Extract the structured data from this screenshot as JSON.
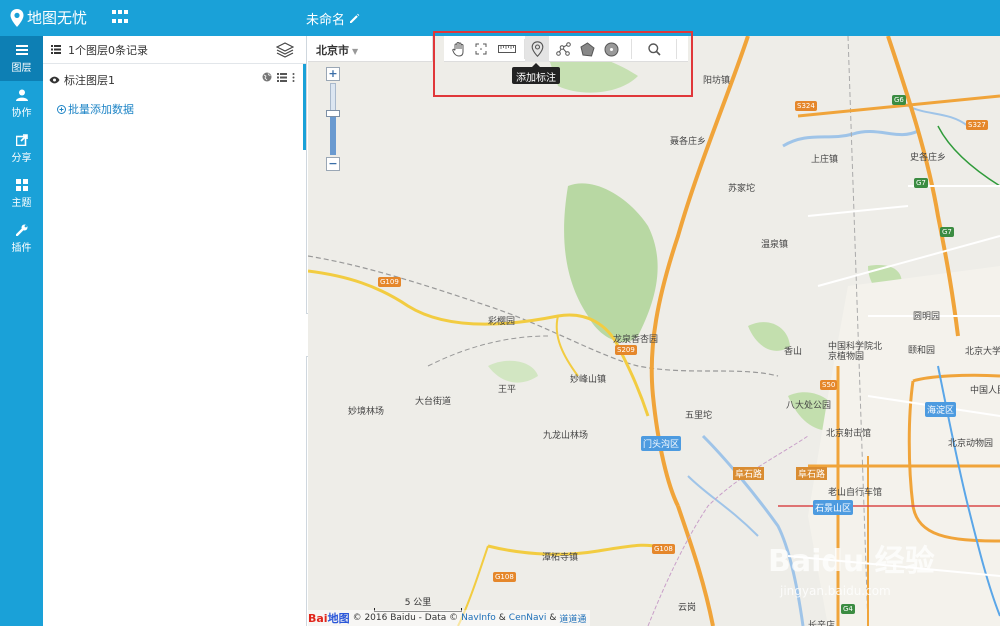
{
  "header": {
    "logo_text": "地图无忧",
    "doc_title": "未命名"
  },
  "rail": {
    "items": [
      {
        "label": "图层",
        "active": true
      },
      {
        "label": "协作"
      },
      {
        "label": "分享"
      },
      {
        "label": "主题"
      },
      {
        "label": "插件"
      }
    ]
  },
  "panel": {
    "summary": "1个图层0条记录",
    "layer_name": "标注图层1",
    "batch_add": "批量添加数据"
  },
  "map": {
    "city": "北京市",
    "tooltip": "添加标注",
    "tools": [
      "pan-tool",
      "fullscreen-tool",
      "measure-tool",
      "add-marker-tool",
      "add-line-tool",
      "add-polygon-tool",
      "add-circle-tool",
      "search-tool"
    ],
    "scale_label": "5 公里",
    "copyright": {
      "logo_a": "Bai",
      "logo_b": "地图",
      "text": "© 2016 Baidu - Data ©",
      "link1": "NavInfo",
      "amp1": "&",
      "link2": "CenNavi",
      "amp2": "&",
      "link3": "道道通"
    },
    "places": [
      "阳坊镇",
      "聂各庄乡",
      "苏家坨",
      "上庄镇",
      "史各庄乡",
      "温泉镇",
      "彩樱园",
      "龙泉香杏园",
      "妙峰山镇",
      "王平",
      "大台街道",
      "妙境林场",
      "九龙山林场",
      "五里坨",
      "潭柘寺镇",
      "云岗",
      "圆明园",
      "中国科学院北京植物园",
      "香山",
      "颐和园",
      "北京大学",
      "八大处公园",
      "北京射击馆",
      "中国人民",
      "北京动物园",
      "老山自行车馆",
      "长辛店",
      "阜石路",
      "阜石路"
    ],
    "districts": [
      "海淀区",
      "门头沟区",
      "石景山区"
    ],
    "roads": [
      "G109",
      "S209",
      "G108",
      "G108",
      "S324",
      "G6",
      "S327",
      "G7",
      "G7",
      "S50",
      "G4"
    ],
    "watermark": "Baidu 经验",
    "watermark_sub": "jingyan.baidu.com"
  },
  "colors": {
    "brand": "#1aa1d8",
    "rail_active": "#0d7fb4",
    "highlight": "#e0373a"
  }
}
